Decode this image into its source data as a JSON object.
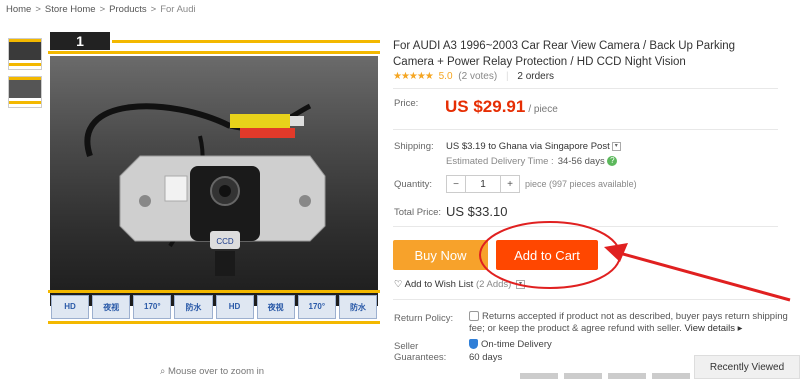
{
  "breadcrumb": [
    "Home",
    "Store Home",
    "Products",
    "For Audi"
  ],
  "product": {
    "title": "For AUDI A3 1996~2003 Car Rear View Camera / Back Up Parking Camera + Power Relay Protection / HD CCD Night Vision",
    "stars": "★★★★★",
    "rating": "5.0",
    "votes": "(2 votes)",
    "orders": "2 orders",
    "image_badge": "1",
    "camera_label": "CCD"
  },
  "price": {
    "label": "Price:",
    "value": "US $29.91",
    "unit": "/ piece"
  },
  "shipping": {
    "label": "Shipping:",
    "value": "US $3.19 to Ghana via Singapore Post",
    "eta_label": "Estimated Delivery Time :",
    "eta_value": "34-56 days"
  },
  "quantity": {
    "label": "Quantity:",
    "minus": "−",
    "value": "1",
    "plus": "+",
    "available": "piece (997 pieces available)"
  },
  "total": {
    "label": "Total Price:",
    "value": "US $33.10"
  },
  "actions": {
    "buy_now": "Buy Now",
    "add_to_cart": "Add to Cart",
    "wishlist": "Add to Wish List",
    "wishlist_count": "(2 Adds)"
  },
  "return_policy": {
    "label": "Return Policy:",
    "text": "Returns accepted if product not as described, buyer pays return shipping fee; or keep the product & agree refund with seller.",
    "link": "View details ▸"
  },
  "seller_guarantees": {
    "label1": "Seller",
    "label2": "Guarantees:",
    "item1": "On-time Delivery",
    "item2": "60 days"
  },
  "image_icons": [
    "HD",
    "夜视",
    "170°",
    "防水",
    "HD",
    "夜视",
    "170°",
    "防水"
  ],
  "zoom_hint": "Mouse over to zoom in",
  "recently_viewed": "Recently Viewed",
  "colors": {
    "accent_price": "#e62e04",
    "buy_now": "#f7a22b",
    "add_to_cart": "#ff4700",
    "callout": "#e02020",
    "star": "#f5a623"
  }
}
